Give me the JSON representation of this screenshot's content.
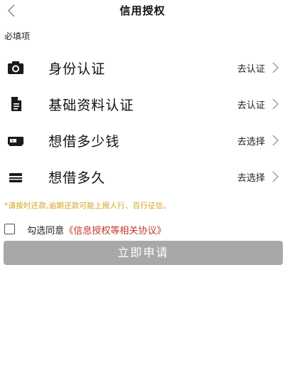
{
  "header": {
    "title": "信用授权",
    "back_icon": "chevron-left-icon"
  },
  "section_label": "必填项",
  "rows": [
    {
      "icon": "camera-icon",
      "label": "身份认证",
      "action": "去认证"
    },
    {
      "icon": "document-icon",
      "label": "基础资料认证",
      "action": "去认证"
    },
    {
      "icon": "banknote-icon",
      "label": "想借多少钱",
      "action": "去选择"
    },
    {
      "icon": "card-icon",
      "label": "想借多久",
      "action": "去选择"
    }
  ],
  "notice": "*请按时还款,逾期还款可能上报人行、百行征信。",
  "agreement": {
    "prefix": "勾选同意",
    "link": "《信息授权等相关协议》",
    "checked": false
  },
  "submit_label": "立即申请",
  "colors": {
    "notice": "#d8a21f",
    "link": "#c0392b",
    "button": "#a8a8a8"
  }
}
